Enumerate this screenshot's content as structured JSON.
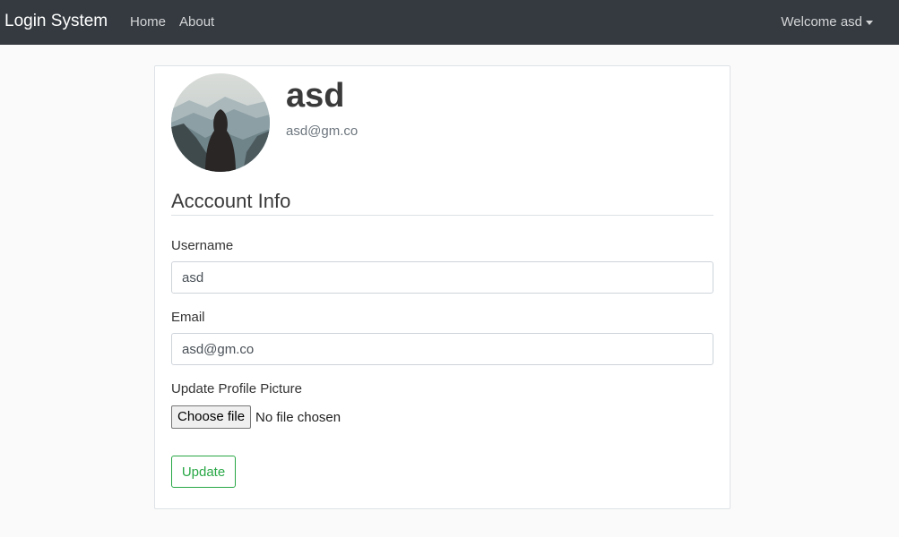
{
  "navbar": {
    "brand": "Login System",
    "links": [
      {
        "label": "Home"
      },
      {
        "label": "About"
      }
    ],
    "user_menu": "Welcome asd"
  },
  "profile": {
    "name": "asd",
    "email": "asd@gm.co"
  },
  "account_info": {
    "title": "Acccount Info",
    "username_label": "Username",
    "username_value": "asd",
    "email_label": "Email",
    "email_value": "asd@gm.co",
    "picture_label": "Update Profile Picture",
    "file_button": "Choose file",
    "file_status": "No file chosen",
    "update_button": "Update"
  },
  "colors": {
    "navbar_bg": "#343a40",
    "accent_success": "#28a745",
    "page_bg": "#fafafa"
  },
  "icons": {
    "user_menu_caret": "caret-down-icon",
    "avatar_image": "hooded-figure-mountains"
  }
}
